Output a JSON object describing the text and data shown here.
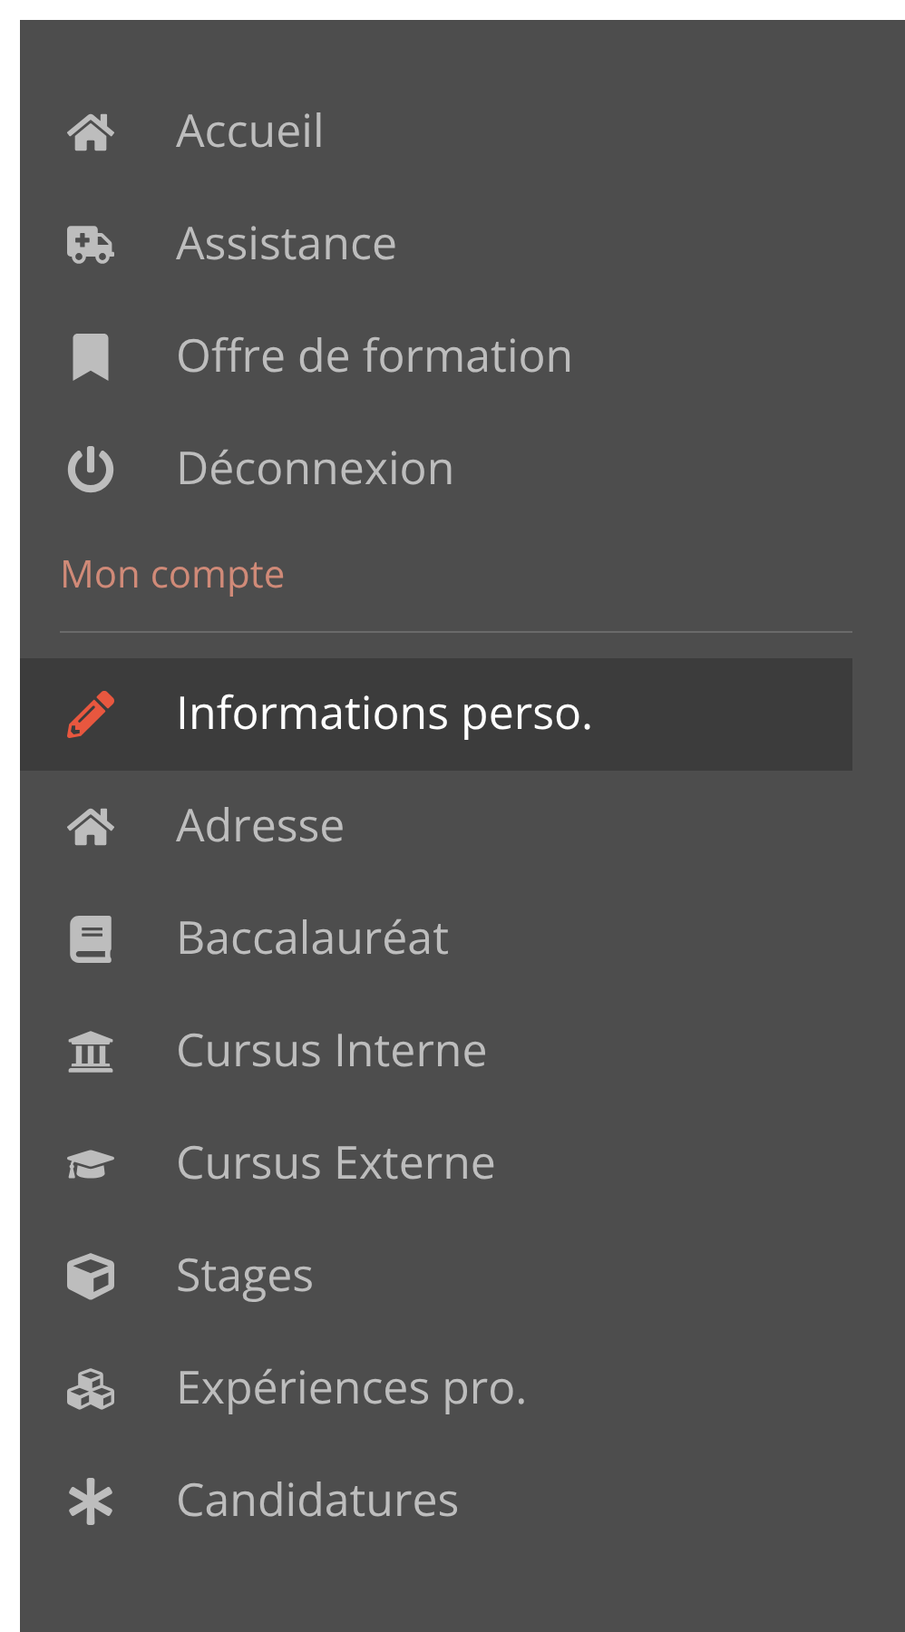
{
  "menu": {
    "items": [
      {
        "label": "Accueil",
        "selected": false
      },
      {
        "label": "Assistance",
        "selected": false
      },
      {
        "label": "Offre de formation",
        "selected": false
      },
      {
        "label": "Déconnexion",
        "selected": false
      }
    ]
  },
  "account": {
    "heading": "Mon compte",
    "items": [
      {
        "label": "Informations perso.",
        "selected": true
      },
      {
        "label": "Adresse",
        "selected": false
      },
      {
        "label": "Baccalauréat",
        "selected": false
      },
      {
        "label": "Cursus Interne",
        "selected": false
      },
      {
        "label": "Cursus Externe",
        "selected": false
      },
      {
        "label": "Stages",
        "selected": false
      },
      {
        "label": "Expériences pro.",
        "selected": false
      },
      {
        "label": "Candidatures",
        "selected": false
      }
    ]
  }
}
